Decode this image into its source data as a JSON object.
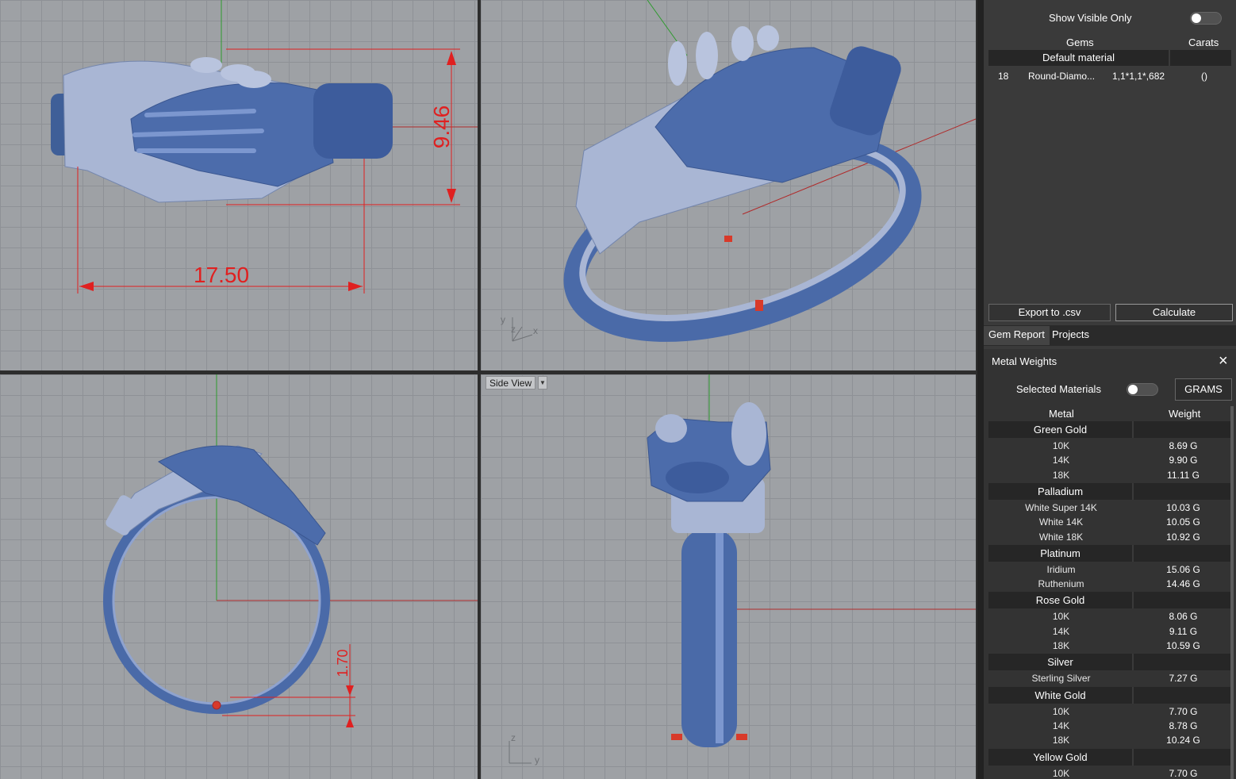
{
  "viewports": {
    "top": {
      "dim_width": "17.50",
      "dim_height": "9.46"
    },
    "front": {
      "dim_thickness": "1.70"
    },
    "perspective": {
      "axis_x": "x",
      "axis_y": "y",
      "axis_z": "z"
    },
    "side": {
      "label": "Side View",
      "axis_z": "z",
      "axis_y": "y"
    }
  },
  "gem_report": {
    "show_visible_only_label": "Show Visible Only",
    "columns": {
      "gems": "Gems",
      "carats": "Carats"
    },
    "group": "Default material",
    "rows": [
      {
        "count": "18",
        "name": "Round-Diamo...",
        "size": "1,1*1,1*,682",
        "carats": "()"
      }
    ],
    "export_label": "Export to .csv",
    "calculate_label": "Calculate"
  },
  "tabs": [
    {
      "label": "Gem Report"
    },
    {
      "label": "Projects"
    }
  ],
  "metal_weights": {
    "title": "Metal Weights",
    "close_icon": "×",
    "selected_materials_label": "Selected Materials",
    "units_label": "GRAMS",
    "columns": {
      "metal": "Metal",
      "weight": "Weight"
    },
    "groups": [
      {
        "name": "Green Gold",
        "rows": [
          {
            "metal": "10K",
            "weight": "8.69 G"
          },
          {
            "metal": "14K",
            "weight": "9.90 G"
          },
          {
            "metal": "18K",
            "weight": "11.11 G"
          }
        ]
      },
      {
        "name": "Palladium",
        "rows": [
          {
            "metal": "White Super 14K",
            "weight": "10.03 G"
          },
          {
            "metal": "White 14K",
            "weight": "10.05 G"
          },
          {
            "metal": "White 18K",
            "weight": "10.92 G"
          }
        ]
      },
      {
        "name": "Platinum",
        "rows": [
          {
            "metal": "Iridium",
            "weight": "15.06 G"
          },
          {
            "metal": "Ruthenium",
            "weight": "14.46 G"
          }
        ]
      },
      {
        "name": "Rose Gold",
        "rows": [
          {
            "metal": "10K",
            "weight": "8.06 G"
          },
          {
            "metal": "14K",
            "weight": "9.11 G"
          },
          {
            "metal": "18K",
            "weight": "10.59 G"
          }
        ]
      },
      {
        "name": "Silver",
        "rows": [
          {
            "metal": "Sterling Silver",
            "weight": "7.27 G"
          }
        ]
      },
      {
        "name": "White Gold",
        "rows": [
          {
            "metal": "10K",
            "weight": "7.70 G"
          },
          {
            "metal": "14K",
            "weight": "8.78 G"
          },
          {
            "metal": "18K",
            "weight": "10.24 G"
          }
        ]
      },
      {
        "name": "Yellow Gold",
        "rows": [
          {
            "metal": "10K",
            "weight": "7.70 G"
          }
        ]
      }
    ]
  },
  "colors": {
    "viewport_bg": "#9ea1a5",
    "model_blue": "#4a6aa8",
    "model_light": "#a9b6d4",
    "dimension_red": "#e02020",
    "panel_bg": "#3a3a3a"
  }
}
